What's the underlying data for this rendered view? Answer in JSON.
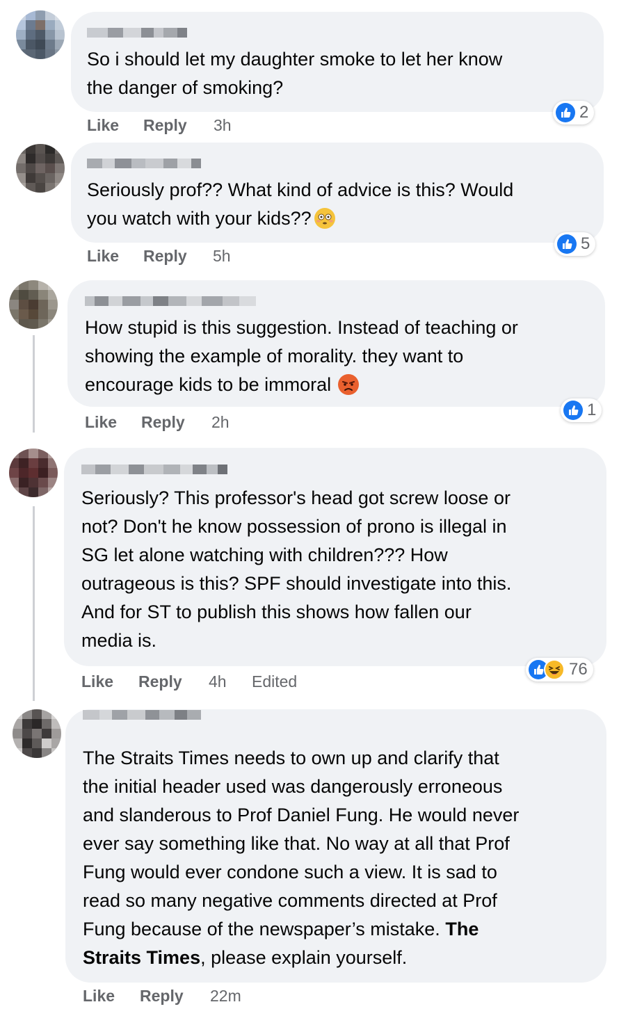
{
  "comments": [
    {
      "text_lines": [
        "So i should let my daughter smoke to let her know",
        "the danger of smoking?"
      ],
      "like_label": "Like",
      "reply_label": "Reply",
      "time": "3h",
      "reaction_count": "2"
    },
    {
      "text_lines": [
        "Seriously prof?? What kind of advice is this? Would",
        "you watch with your kids??"
      ],
      "emoji": "flushed-face-emoji",
      "like_label": "Like",
      "reply_label": "Reply",
      "time": "5h",
      "reaction_count": "5"
    },
    {
      "text_lines": [
        "How stupid is this suggestion. Instead of teaching or",
        "showing the example of morality. they want to",
        "encourage kids to be immoral"
      ],
      "emoji": "angry-face-emoji",
      "like_label": "Like",
      "reply_label": "Reply",
      "time": "2h",
      "reaction_count": "1"
    },
    {
      "text_lines": [
        "Seriously? This professor's head got screw loose or",
        "not? Don't he know possession of prono is illegal in",
        "SG let alone watching with children??? How",
        "outrageous is this? SPF should investigate into this.",
        "And for ST to publish this shows how fallen our",
        "media is."
      ],
      "like_label": "Like",
      "reply_label": "Reply",
      "time": "4h",
      "edited": "Edited",
      "reaction_count": "76",
      "reactions": [
        "like-icon",
        "haha-icon"
      ]
    },
    {
      "text_lines": [
        "The Straits Times needs to own up and clarify that",
        "the initial header used was dangerously erroneous",
        "and slanderous to Prof Daniel Fung. He would never",
        "ever say something like that. No way at all that Prof",
        "Fung would ever condone such a view. It is sad to",
        "read so many negative comments directed at Prof",
        "Fung because of the newspaper’s mistake."
      ],
      "bold_mention_1": "The",
      "bold_mention_2": "Straits Times",
      "tail_text": ", please explain yourself.",
      "like_label": "Like",
      "reply_label": "Reply",
      "time": "22m"
    }
  ],
  "colors": {
    "bubble": "#f0f2f5",
    "meta_text": "#65676b",
    "like_blue": "#1877f2",
    "thread_line": "#ced0d4"
  }
}
